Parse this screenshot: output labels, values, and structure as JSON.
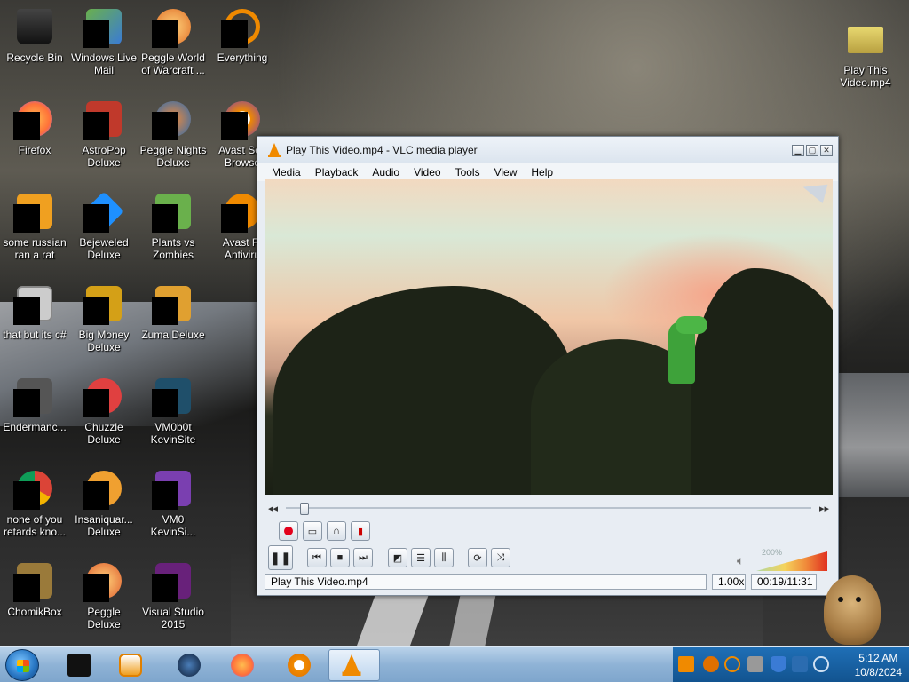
{
  "desktop": {
    "icons": [
      {
        "label": "Recycle Bin",
        "icon": "recycle-bin-icon",
        "color": "#222"
      },
      {
        "label": "Windows Live Mail",
        "icon": "mail-icon",
        "color": "#3a7bd5"
      },
      {
        "label": "Peggle World of Warcraft ...",
        "icon": "peggle-icon",
        "color": "#e0702a"
      },
      {
        "label": "Everything",
        "icon": "everything-icon",
        "color": "#f08a00"
      },
      {
        "label": "Firefox",
        "icon": "firefox-icon",
        "color": "#ff7139"
      },
      {
        "label": "AstroPop Deluxe",
        "icon": "astropop-icon",
        "color": "#c0392b"
      },
      {
        "label": "Peggle Nights Deluxe",
        "icon": "peggle-nights-icon",
        "color": "#2b6cb0"
      },
      {
        "label": "Avast Sec Browse",
        "icon": "avast-browser-icon",
        "color": "#f08a00"
      },
      {
        "label": "some russian ran a rat",
        "icon": "document-icon",
        "color": "#f0a020"
      },
      {
        "label": "Bejeweled Deluxe",
        "icon": "bejeweled-icon",
        "color": "#1e90ff"
      },
      {
        "label": "Plants vs Zombies",
        "icon": "pvz-icon",
        "color": "#6ab04c"
      },
      {
        "label": "Avast Fr Antiviru",
        "icon": "avast-antivirus-icon",
        "color": "#f08a00"
      },
      {
        "label": "that but its c#",
        "icon": "folder-stack-icon",
        "color": "#ccc"
      },
      {
        "label": "Big Money Deluxe",
        "icon": "bigmoney-icon",
        "color": "#d4a017"
      },
      {
        "label": "Zuma Deluxe",
        "icon": "zuma-icon",
        "color": "#e0a030"
      },
      {
        "label": "Endermanc...",
        "icon": "app-icon",
        "color": "#555"
      },
      {
        "label": "Chuzzle Deluxe",
        "icon": "chuzzle-icon",
        "color": "#e04040"
      },
      {
        "label": "VM0b0t KevinSite",
        "icon": "vm-icon",
        "color": "#2a6"
      },
      {
        "label": "none of you retards kno...",
        "icon": "chrome-icon",
        "color": "#db4437"
      },
      {
        "label": "Insaniquar... Deluxe",
        "icon": "insaniquarium-icon",
        "color": "#f0a030"
      },
      {
        "label": "VM0 KevinSi...",
        "icon": "vm-icon-2",
        "color": "#7a3fb0"
      },
      {
        "label": "ChomikBox",
        "icon": "chomikbox-icon",
        "color": "#9a7a3a"
      },
      {
        "label": "Peggle Deluxe",
        "icon": "peggle-deluxe-icon",
        "color": "#e06030"
      },
      {
        "label": "Visual Studio 2015",
        "icon": "visual-studio-icon",
        "color": "#68217a"
      },
      {
        "label": "Play This Video.mp4",
        "icon": "video-file-icon",
        "color": "#d4c060"
      }
    ]
  },
  "vlc": {
    "title": "Play This Video.mp4 - VLC media player",
    "menu": [
      "Media",
      "Playback",
      "Audio",
      "Video",
      "Tools",
      "View",
      "Help"
    ],
    "window_controls": {
      "minimize": "▁",
      "maximize": "▢",
      "close": "✕"
    },
    "volume_label": "200%",
    "volume_level": 1.0,
    "seek_progress": 0.027,
    "status": {
      "filename": "Play This Video.mp4",
      "speed": "1.00x",
      "time": "00:19/11:31"
    },
    "accent": "#f08a00"
  },
  "taskbar": {
    "clock_time": "5:12 AM",
    "clock_date": "10/8/2024",
    "items": [
      "terminal-icon",
      "media-player-icon",
      "steam-icon",
      "firefox-icon",
      "avast-browser-icon",
      "vlc-icon"
    ],
    "tray": [
      "vlc-tray-icon",
      "avast-tray-icon",
      "search-tray-icon",
      "app-tray-icon",
      "shield-tray-icon",
      "display-tray-icon",
      "volume-tray-icon"
    ]
  }
}
